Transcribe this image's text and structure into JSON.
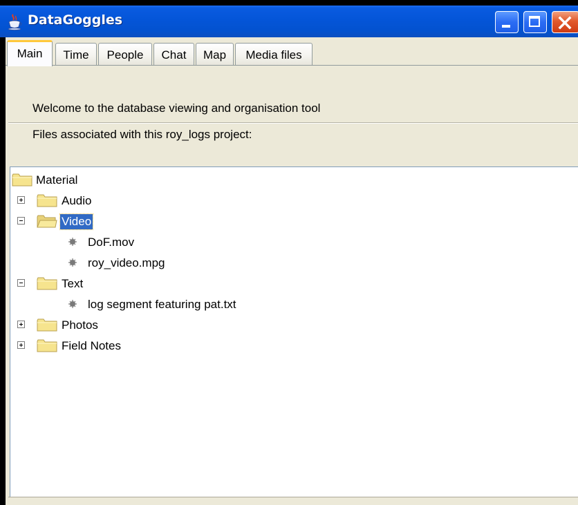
{
  "window": {
    "title": "DataGoggles",
    "controls": {
      "minimize": "minimize-icon",
      "maximize": "maximize-icon",
      "close": "close-icon"
    }
  },
  "tabs": [
    {
      "label": "Main",
      "active": true
    },
    {
      "label": "Time",
      "active": false
    },
    {
      "label": "People",
      "active": false
    },
    {
      "label": "Chat",
      "active": false
    },
    {
      "label": "Map",
      "active": false
    },
    {
      "label": "Media files",
      "active": false
    }
  ],
  "main": {
    "welcome_text": "Welcome to the database viewing and organisation tool",
    "files_label": "Files associated with this roy_logs project:"
  },
  "tree": {
    "root": {
      "label": "Material",
      "icon": "folder-icon"
    },
    "nodes": [
      {
        "label": "Audio",
        "icon": "folder-icon",
        "expanded": false,
        "selected": false,
        "children": []
      },
      {
        "label": "Video",
        "icon": "folder-open-icon",
        "expanded": true,
        "selected": true,
        "children": [
          {
            "label": "DoF.mov"
          },
          {
            "label": "roy_video.mpg"
          }
        ]
      },
      {
        "label": "Text",
        "icon": "folder-icon",
        "expanded": true,
        "selected": false,
        "children": [
          {
            "label": "log segment featuring pat.txt"
          }
        ]
      },
      {
        "label": "Photos",
        "icon": "folder-icon",
        "expanded": false,
        "selected": false,
        "children": []
      },
      {
        "label": "Field Notes",
        "icon": "folder-icon",
        "expanded": false,
        "selected": false,
        "children": []
      }
    ]
  },
  "colors": {
    "titlebar": "#0455d8",
    "selection": "#316ac5",
    "client_bg": "#ece9d8",
    "tab_highlight": "#ffc83c"
  }
}
